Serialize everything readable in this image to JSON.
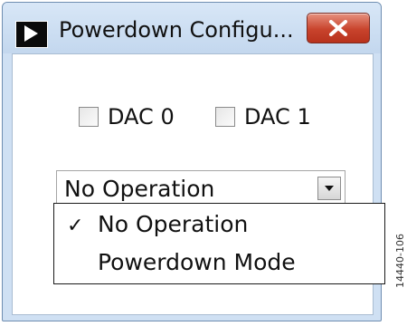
{
  "window": {
    "title": "Powerdown Configu...",
    "icon": "play-triangle-icon",
    "close_icon": "close-icon"
  },
  "checkboxes": [
    {
      "label": "DAC 0",
      "checked": false
    },
    {
      "label": "DAC 1",
      "checked": false
    }
  ],
  "combo": {
    "selected": "No Operation",
    "arrow_icon": "chevron-down-icon"
  },
  "dropdown": {
    "items": [
      {
        "label": "No Operation",
        "check_mark": "✓",
        "selected": true
      },
      {
        "label": "Powerdown Mode",
        "check_mark": "",
        "selected": false
      }
    ]
  },
  "figure_id": "14440-106",
  "colors": {
    "close_button": "#c8432c",
    "title_bar": "#c3d7ee"
  }
}
